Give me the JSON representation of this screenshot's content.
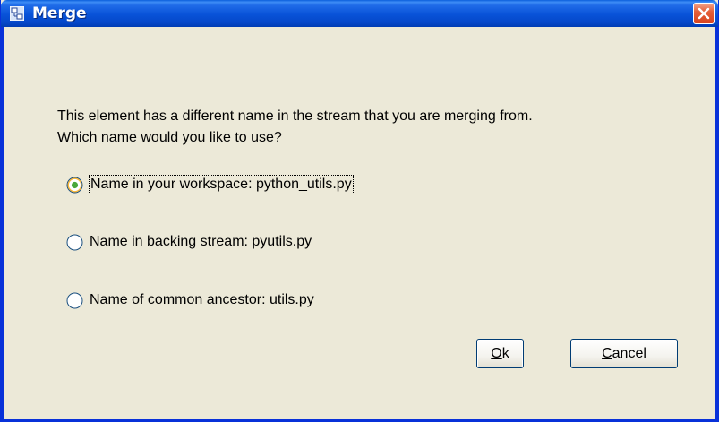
{
  "window": {
    "title": "Merge",
    "icon": "merge-app-icon",
    "close_icon": "close-icon"
  },
  "message": {
    "line1": "This element has a different name in the stream that you are merging from.",
    "line2": "Which name would you like to use?"
  },
  "options": [
    {
      "label": "Name in your workspace: python_utils.py",
      "selected": true
    },
    {
      "label": "Name in backing stream: pyutils.py",
      "selected": false
    },
    {
      "label": "Name of common ancestor: utils.py",
      "selected": false
    }
  ],
  "buttons": {
    "ok": {
      "mnemonic": "O",
      "rest": "k"
    },
    "cancel": {
      "mnemonic": "C",
      "rest": "ancel"
    }
  },
  "colors": {
    "titlebar": "#0852d8",
    "dialog_bg": "#ece9d8",
    "radio_selected_dot": "#4aa83b"
  }
}
